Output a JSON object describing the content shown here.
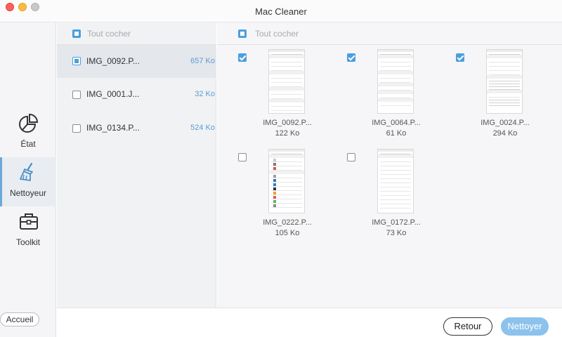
{
  "window": {
    "title": "Mac Cleaner"
  },
  "sidebar": {
    "items": [
      {
        "label": "État",
        "icon": "pie-chart-icon"
      },
      {
        "label": "Nettoyeur",
        "icon": "broom-icon",
        "active": true
      },
      {
        "label": "Toolkit",
        "icon": "toolbox-icon"
      }
    ],
    "home_label": "Accueil"
  },
  "list": {
    "select_all_label": "Tout cocher",
    "files": [
      {
        "name": "IMG_0092.P...",
        "size": "657 Ko",
        "selected": true
      },
      {
        "name": "IMG_0001.J...",
        "size": "32 Ko",
        "selected": false
      },
      {
        "name": "IMG_0134.P...",
        "size": "524 Ko",
        "selected": false
      }
    ]
  },
  "grid": {
    "select_all_label": "Tout cocher",
    "items": [
      {
        "name": "IMG_0092.P...",
        "size": "122 Ko",
        "checked": true
      },
      {
        "name": "IMG_0064.P...",
        "size": "61 Ko",
        "checked": true
      },
      {
        "name": "IMG_0024.P...",
        "size": "294 Ko",
        "checked": true
      },
      {
        "name": "IMG_0222.P...",
        "size": "105 Ko",
        "checked": false
      },
      {
        "name": "IMG_0172.P...",
        "size": "73 Ko",
        "checked": false
      }
    ]
  },
  "footer": {
    "back_label": "Retour",
    "clean_label": "Nettoyer"
  },
  "colors": {
    "accent": "#4a9fdf",
    "clean_button": "#8cc2ec",
    "size_text": "#5b9bd5"
  }
}
